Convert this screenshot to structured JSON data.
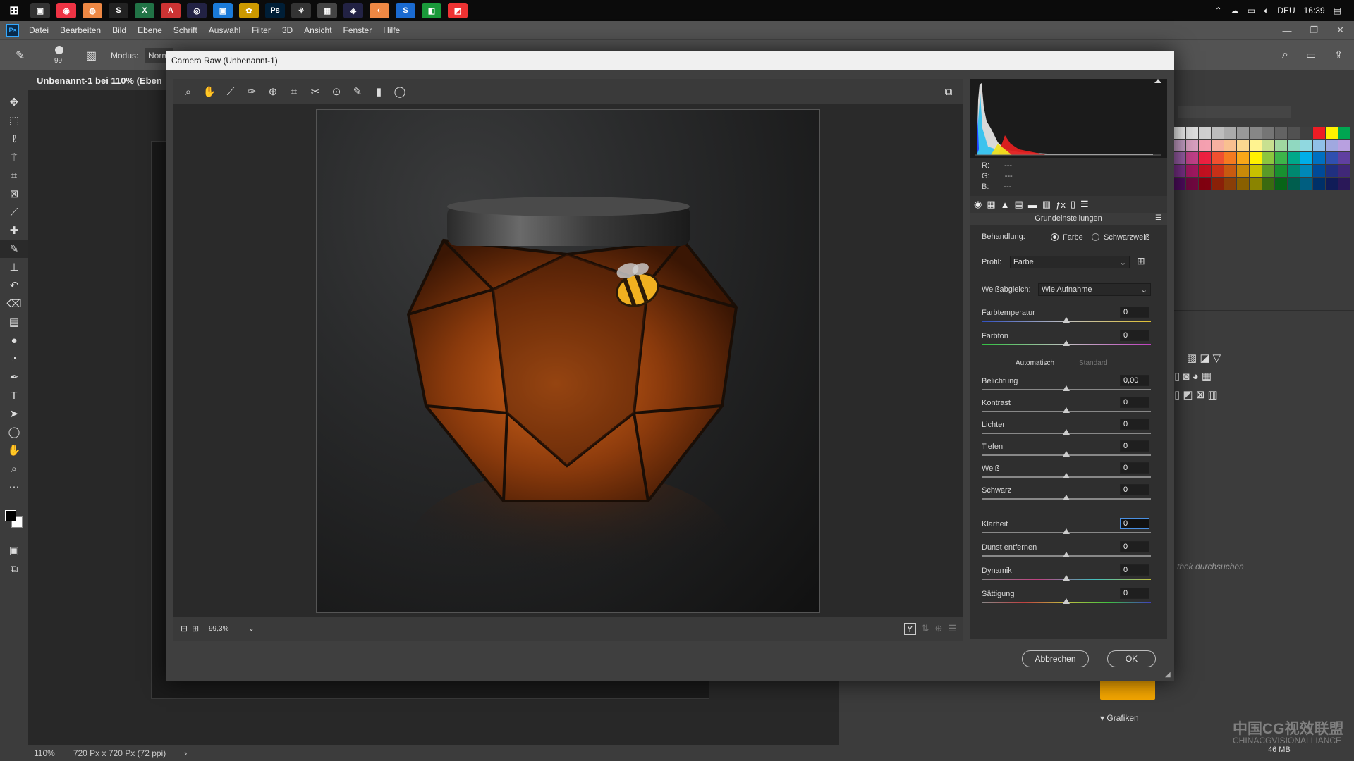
{
  "taskbar": {
    "apps": [
      "▣",
      "◉",
      "◍",
      "S",
      "X",
      "A",
      "◎",
      "▣",
      "✿",
      "Ps",
      "⚘",
      "▦",
      "◈",
      "◐",
      "S",
      "◧",
      "◩"
    ],
    "lang": "DEU",
    "time": "16:39"
  },
  "menubar": {
    "logo": "Ps",
    "items": [
      "Datei",
      "Bearbeiten",
      "Bild",
      "Ebene",
      "Schrift",
      "Auswahl",
      "Filter",
      "3D",
      "Ansicht",
      "Fenster",
      "Hilfe"
    ]
  },
  "optbar": {
    "brush_size": "99",
    "mode_label": "Modus:",
    "mode_value": "Norm"
  },
  "doc": {
    "tab": "Unbenannt-1 bei 110% (Eben",
    "zoom": "110%",
    "size": "720 Px x 720 Px (72 ppi)"
  },
  "dialog": {
    "title": "Camera Raw (Unbenannt-1)",
    "zoom": "99,3%",
    "rgb": {
      "r": "R:",
      "g": "G:",
      "b": "B:",
      "dash": "---"
    },
    "panel_title": "Grundeinstellungen",
    "behandlung": {
      "label": "Behandlung:",
      "farbe": "Farbe",
      "sw": "Schwarzweiß"
    },
    "profil": {
      "label": "Profil:",
      "value": "Farbe"
    },
    "wb": {
      "label": "Weißabgleich:",
      "value": "Wie Aufnahme"
    },
    "auto": "Automatisch",
    "standard": "Standard",
    "sliders": [
      {
        "label": "Farbtemperatur",
        "value": "0"
      },
      {
        "label": "Farbton",
        "value": "0"
      },
      {
        "label": "Belichtung",
        "value": "0,00"
      },
      {
        "label": "Kontrast",
        "value": "0"
      },
      {
        "label": "Lichter",
        "value": "0"
      },
      {
        "label": "Tiefen",
        "value": "0"
      },
      {
        "label": "Weiß",
        "value": "0"
      },
      {
        "label": "Schwarz",
        "value": "0"
      },
      {
        "label": "Klarheit",
        "value": "0"
      },
      {
        "label": "Dunst entfernen",
        "value": "0"
      },
      {
        "label": "Dynamik",
        "value": "0"
      },
      {
        "label": "Sättigung",
        "value": "0"
      }
    ],
    "cancel": "Abbrechen",
    "ok": "OK"
  },
  "rpanel": {
    "search": "thek durchsuchen",
    "grafiken": "Grafiken",
    "mem": "46 MB",
    "watermark": "中国CG视效联盟",
    "watermark_sub": "CHINACGVISIONALLIANCE"
  },
  "swatches": [
    "#f2f2f2",
    "#e0e0e0",
    "#cfcfcf",
    "#bdbdbd",
    "#ababab",
    "#999",
    "#878787",
    "#757575",
    "#636363",
    "#515151",
    "#3f3f3f",
    "#ed1c24",
    "#fff200",
    "#00a651",
    "#c8a0c8",
    "#d9a0c0",
    "#f5a0b0",
    "#f7b0a0",
    "#f9c090",
    "#fbd890",
    "#fff390",
    "#c8e090",
    "#a0d8a0",
    "#90d8c0",
    "#90d8e0",
    "#90c0e8",
    "#a0a8e0",
    "#b8a0e0",
    "#9a5fa8",
    "#c04088",
    "#ec2040",
    "#f05030",
    "#f47a20",
    "#f8a818",
    "#fff000",
    "#8cc63e",
    "#3cb44a",
    "#00a88a",
    "#00aee8",
    "#0070c0",
    "#3050b0",
    "#6040a0",
    "#7a3088",
    "#a01860",
    "#c01020",
    "#c83018",
    "#c85a10",
    "#c88a08",
    "#c8c000",
    "#5a9a28",
    "#189030",
    "#008870",
    "#0088b8",
    "#004a98",
    "#203080",
    "#402878",
    "#500c60",
    "#700840",
    "#800010",
    "#8a2008",
    "#8a3e08",
    "#8a6000",
    "#8a8400",
    "#3a6a10",
    "#086418",
    "#005e4e",
    "#005e80",
    "#003068",
    "#101c58",
    "#2a1858"
  ]
}
